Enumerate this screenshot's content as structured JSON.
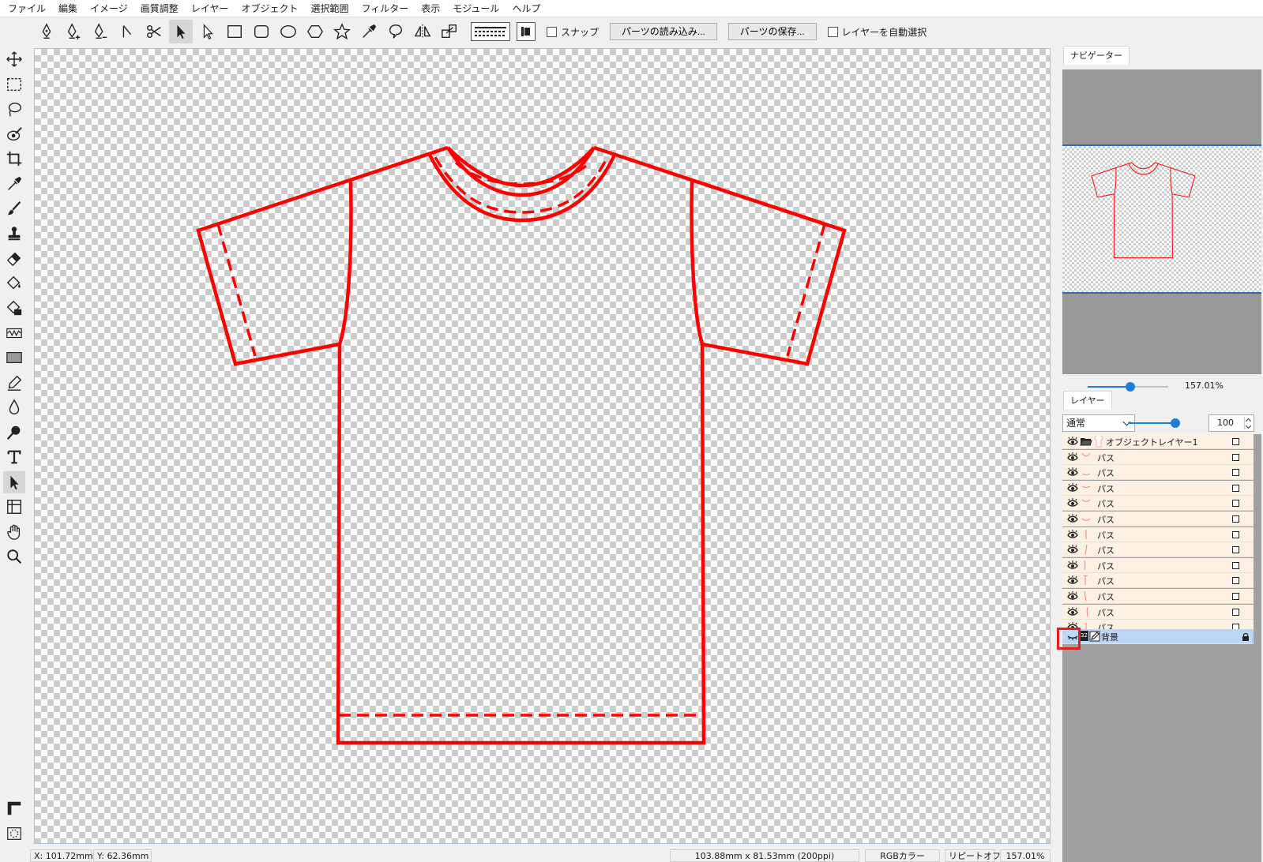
{
  "menu": [
    "ファイル",
    "編集",
    "イメージ",
    "画質調整",
    "レイヤー",
    "オブジェクト",
    "選択範囲",
    "フィルター",
    "表示",
    "モジュール",
    "ヘルプ"
  ],
  "toolbar": {
    "snap_label": "スナップ",
    "load_parts_label": "パーツの読み込み...",
    "save_parts_label": "パーツの保存...",
    "auto_select_label": "レイヤーを自動選択"
  },
  "colors": {
    "accent": "#1e7fd6",
    "stroke": "#ff0000",
    "highlight": "#e81c1c",
    "selected_row": "#bcd6f5",
    "layer_row": "#fdf1e3"
  },
  "statusbar": {
    "x_label": "X:",
    "x_value": "101.72mm",
    "y_label": "Y:",
    "y_value": "62.36mm",
    "doc_size": "103.88mm x 81.53mm (200ppi)",
    "color_mode": "RGBカラー",
    "repeat": "リピートオフ",
    "zoom": "157.01%"
  },
  "navigator": {
    "tab": "ナビゲーター",
    "zoom": "157.01%",
    "zoom_fraction": 0.48
  },
  "layers": {
    "tab": "レイヤー",
    "blend_mode": "通常",
    "opacity": "100",
    "opacity_fraction": 1.0,
    "items": [
      {
        "name": "オブジェクトレイヤー1",
        "kind": "folder"
      },
      {
        "name": "パス",
        "kind": "path"
      },
      {
        "name": "パス",
        "kind": "path"
      },
      {
        "name": "パス",
        "kind": "path"
      },
      {
        "name": "パス",
        "kind": "path"
      },
      {
        "name": "パス",
        "kind": "path"
      },
      {
        "name": "パス",
        "kind": "path"
      },
      {
        "name": "パス",
        "kind": "path"
      },
      {
        "name": "パス",
        "kind": "path"
      },
      {
        "name": "パス",
        "kind": "path"
      },
      {
        "name": "パス",
        "kind": "path"
      },
      {
        "name": "パス",
        "kind": "path"
      },
      {
        "name": "パス",
        "kind": "path"
      }
    ],
    "background": {
      "name": "背景",
      "badge": "32"
    }
  }
}
